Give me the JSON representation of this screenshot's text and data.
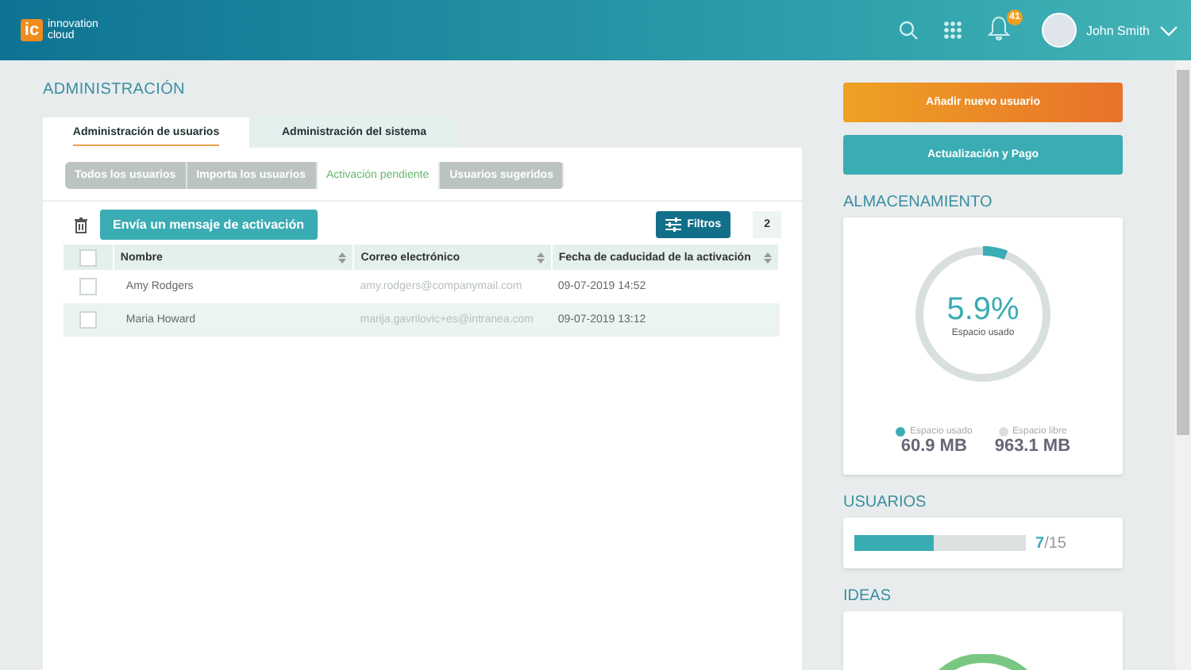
{
  "header": {
    "logo_mark": "ic",
    "logo_text": [
      "innovation",
      "cloud"
    ],
    "notification_count": "41",
    "user_name": "John Smith"
  },
  "page_title": "ADMINISTRACIÓN",
  "tabs": [
    {
      "label": "Administración de usuarios",
      "selected": true
    },
    {
      "label": "Administración del sistema",
      "selected": false
    }
  ],
  "subtabs": [
    {
      "label": "Todos los usuarios",
      "selected": false
    },
    {
      "label": "Importa los usuarios",
      "selected": false
    },
    {
      "label": "Activación pendiente",
      "selected": true
    },
    {
      "label": "Usuarios sugeridos",
      "selected": false
    }
  ],
  "toolbar": {
    "send_button": "Envía un mensaje de activación",
    "filter_button": "Filtros",
    "count": "2"
  },
  "table": {
    "select_all_checked": false,
    "columns": [
      "Nombre",
      "Correo electrónico",
      "Fecha de caducidad de la activación"
    ],
    "rows": [
      {
        "checked": false,
        "name": "Amy Rodgers",
        "email": "amy.rodgers@companymail.com",
        "date": "09-07-2019 14:52"
      },
      {
        "checked": false,
        "name": "Maria Howard",
        "email": "marija.gavrilovic+es@intranea.com",
        "date": "09-07-2019 13:12"
      }
    ]
  },
  "actions": [
    "Añadir nuevo usuario",
    "Actualización y Pago"
  ],
  "storage": {
    "title": "ALMACENAMIENTO",
    "level": 0.059,
    "percent": "5.9%",
    "caption": "Espacio usado",
    "legend": [
      {
        "label": "Espacio usado",
        "value": "60.9 MB",
        "color": "#3aacb3"
      },
      {
        "label": "Espacio libre",
        "value": "963.1 MB",
        "color": "#d9dfdf"
      }
    ]
  },
  "users": {
    "title": "USUARIOS",
    "level": 0.467,
    "used": "7",
    "total": "/15"
  },
  "ideas": {
    "title": "IDEAS"
  }
}
